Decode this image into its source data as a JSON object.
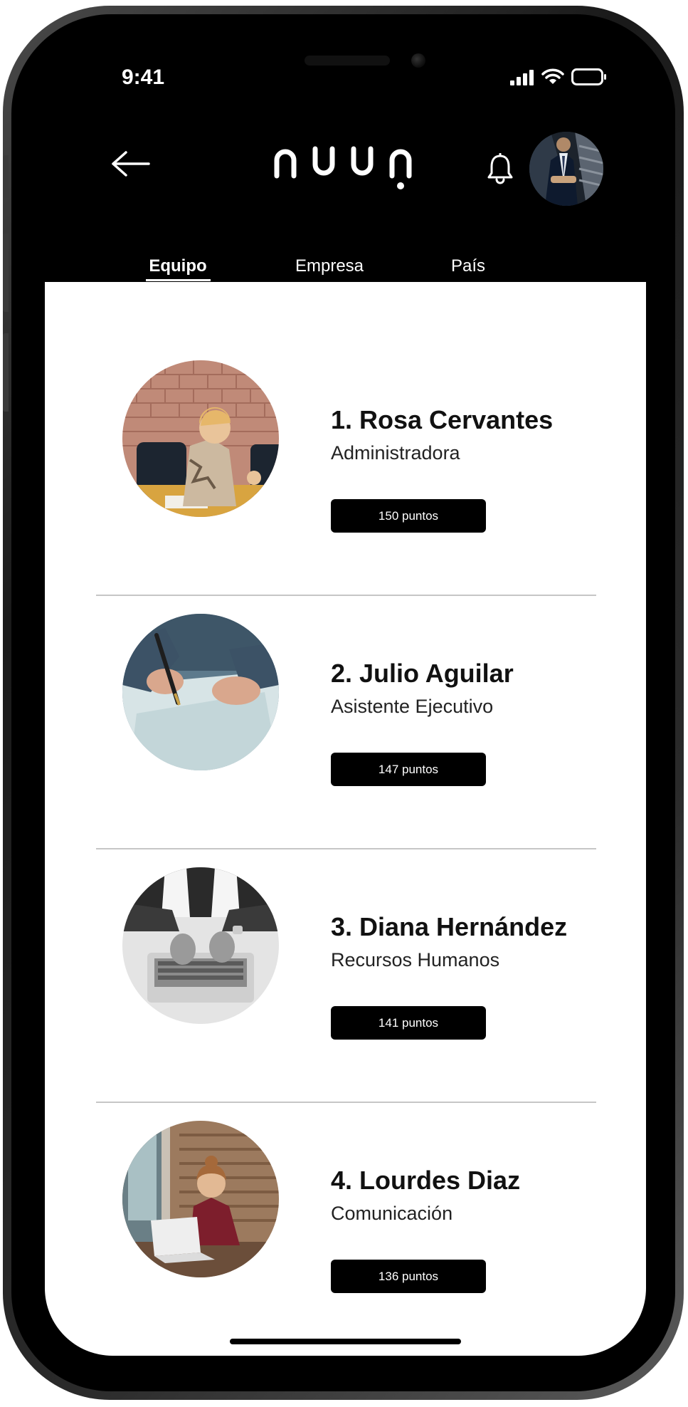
{
  "status_bar": {
    "time": "9:41"
  },
  "header": {
    "logo_text": "nuup",
    "back_icon": "arrow-left-icon",
    "notification_icon": "bell-icon"
  },
  "tabs": [
    {
      "label": "Equipo",
      "active": true
    },
    {
      "label": "Empresa",
      "active": false
    },
    {
      "label": "País",
      "active": false
    }
  ],
  "ranking": [
    {
      "name": "1. Rosa Cervantes",
      "role": "Administradora",
      "points": "150 puntos"
    },
    {
      "name": "2. Julio Aguilar",
      "role": "Asistente Ejecutivo",
      "points": "147 puntos"
    },
    {
      "name": "3. Diana Hernández",
      "role": "Recursos Humanos",
      "points": "141 puntos"
    },
    {
      "name": "4. Lourdes Diaz",
      "role": "Comunicación",
      "points": "136 puntos"
    }
  ],
  "colors": {
    "background": "#000000",
    "surface": "#ffffff",
    "text": "#111111",
    "badge": "#000000",
    "divider": "#c6c6c6"
  }
}
